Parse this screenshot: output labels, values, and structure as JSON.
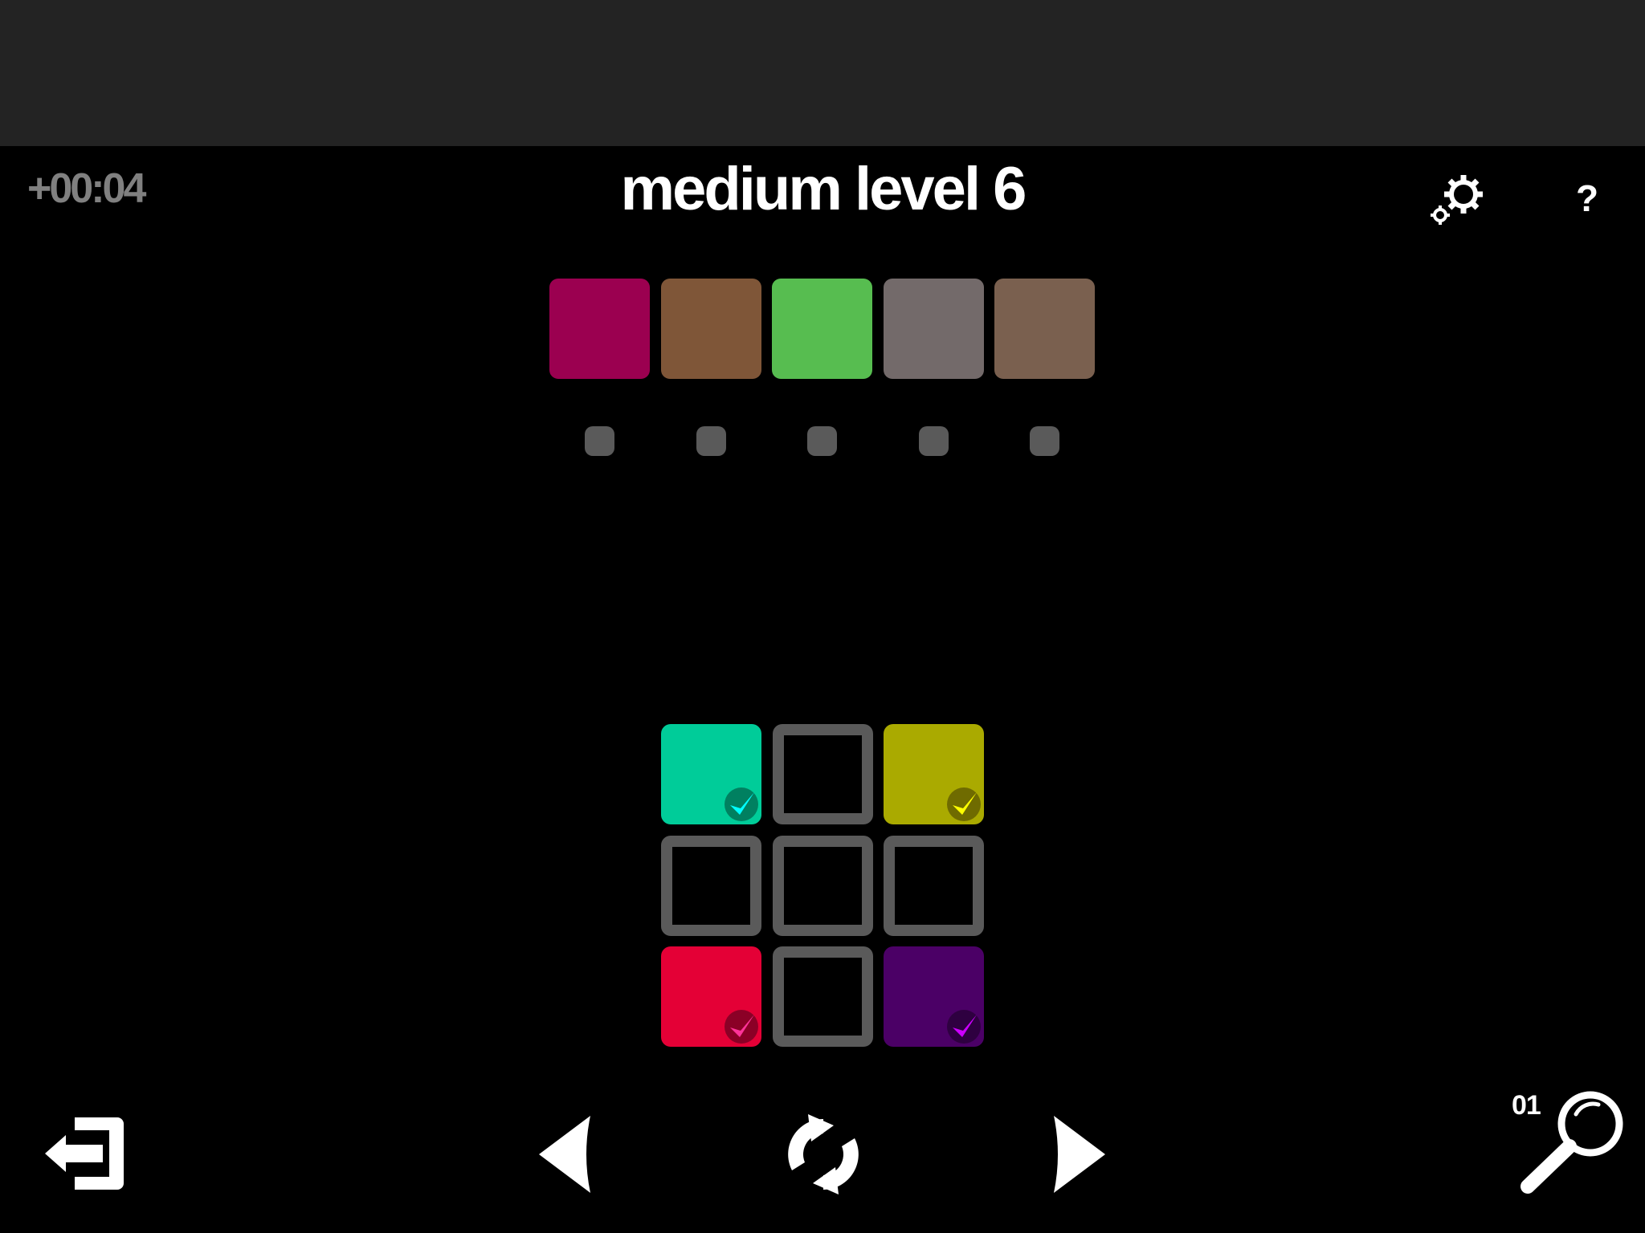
{
  "header": {
    "timer": "+00:04",
    "title": "medium level 6",
    "settings_icon": "gear-icon",
    "help_label": "?"
  },
  "target_colors": [
    {
      "color": "#9b0050"
    },
    {
      "color": "#7f5638"
    },
    {
      "color": "#57bd50"
    },
    {
      "color": "#736a6a"
    },
    {
      "color": "#7a604f"
    }
  ],
  "indicator_dots": [
    {
      "state": "empty"
    },
    {
      "state": "empty"
    },
    {
      "state": "empty"
    },
    {
      "state": "empty"
    },
    {
      "state": "empty"
    }
  ],
  "grid": [
    [
      {
        "color": "#00cc99",
        "check": "#00ffff",
        "badge": "#008060"
      },
      {
        "color": null
      },
      {
        "color": "#aaaa00",
        "check": "#ffff00",
        "badge": "#6f6b00"
      }
    ],
    [
      {
        "color": null
      },
      {
        "color": null
      },
      {
        "color": null
      }
    ],
    [
      {
        "color": "#e40036",
        "check": "#ff3399",
        "badge": "#8b0026"
      },
      {
        "color": null
      },
      {
        "color": "#4b0066",
        "check": "#cc00ff",
        "badge": "#2e0040"
      }
    ]
  ],
  "footer": {
    "exit_icon": "exit-icon",
    "prev_icon": "arrow-left-icon",
    "restart_icon": "refresh-icon",
    "next_icon": "arrow-right-icon",
    "hint_icon": "magnifier-icon",
    "hint_count": "01"
  }
}
